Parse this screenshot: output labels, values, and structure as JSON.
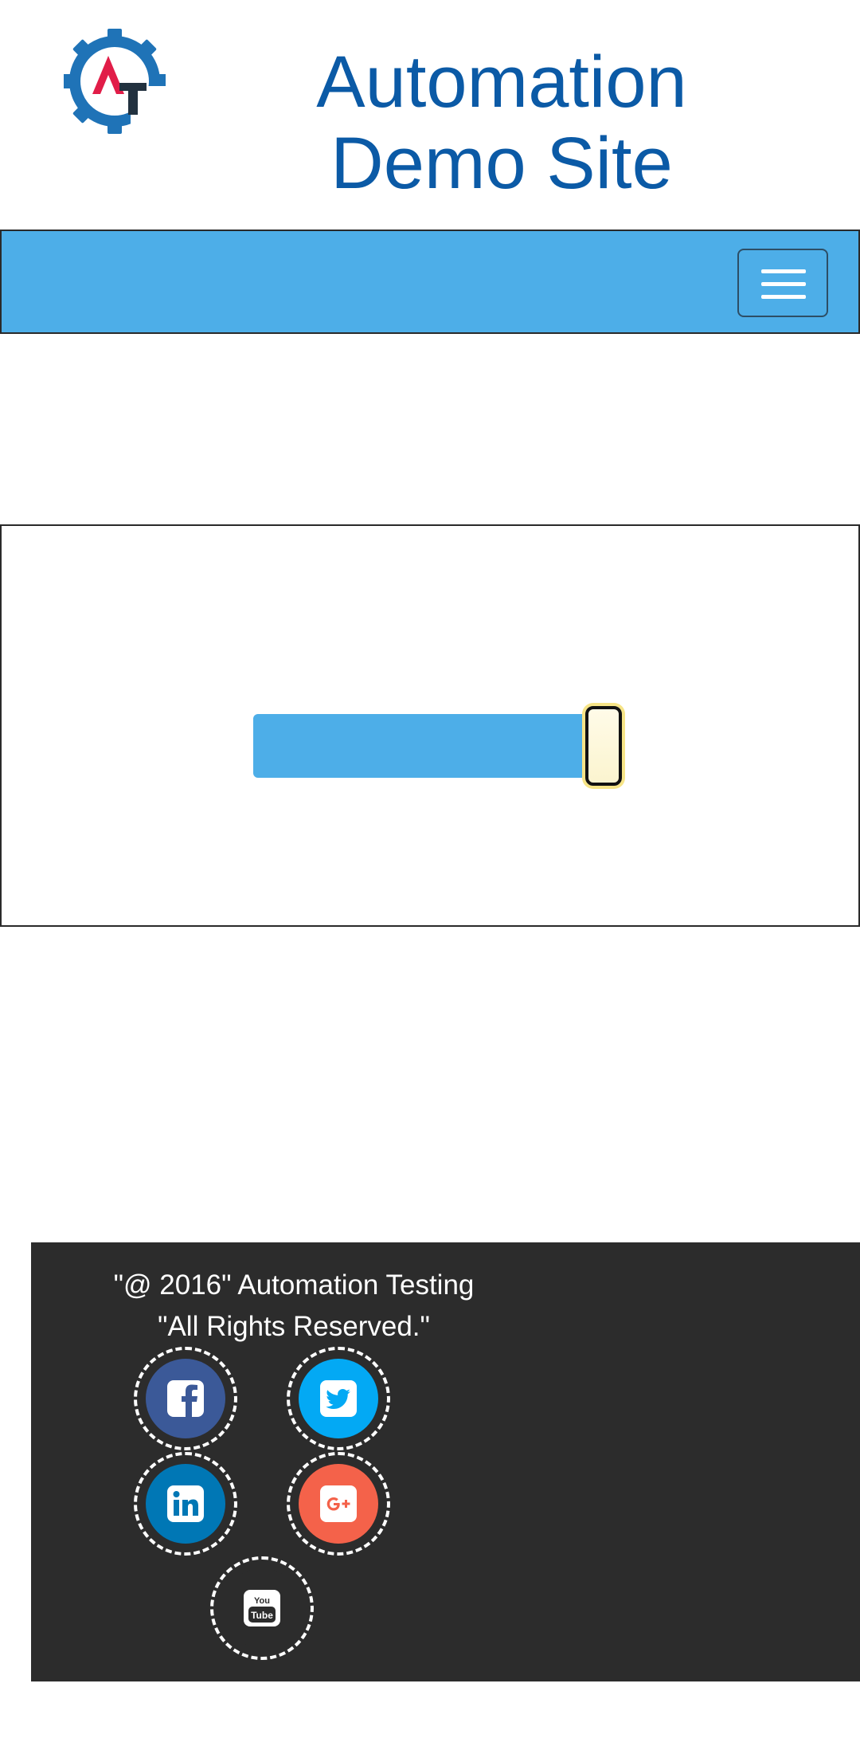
{
  "header": {
    "logo_icon": "gear-at-logo-icon",
    "title_line1": "Automation",
    "title_line2": "Demo Site",
    "title_color": "#0b5aa6"
  },
  "navbar": {
    "background": "#4daee8",
    "menu_icon": "hamburger-menu-icon"
  },
  "slider": {
    "value_fraction": 0.93,
    "range_color": "#4daee8",
    "handle_color": "#fbf4cf"
  },
  "footer": {
    "copyright_line1": "\"@ 2016\" Automation Testing",
    "copyright_line2": "\"All Rights Reserved.\"",
    "background": "#2c2c2c",
    "social": [
      {
        "name": "facebook-icon",
        "color": "#3b5998"
      },
      {
        "name": "twitter-icon",
        "color": "#03a9f4"
      },
      {
        "name": "linkedin-icon",
        "color": "#0077b5"
      },
      {
        "name": "google-plus-icon",
        "color": "#f4624a"
      },
      {
        "name": "youtube-icon",
        "color": "#2c2c2c"
      }
    ]
  }
}
